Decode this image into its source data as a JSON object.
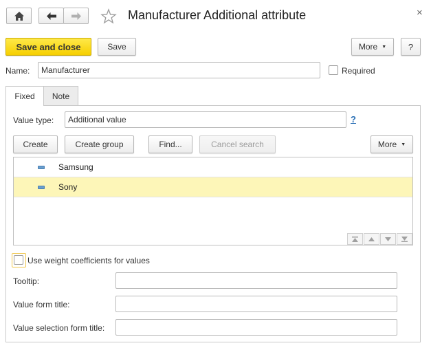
{
  "window": {
    "title": "Manufacturer Additional attribute",
    "close_glyph": "×"
  },
  "toolbar": {
    "save_close_label": "Save and close",
    "save_label": "Save",
    "more_label": "More",
    "help_label": "?"
  },
  "form": {
    "name_label": "Name:",
    "name_value": "Manufacturer",
    "required_label": "Required",
    "required_checked": false
  },
  "tabs": [
    {
      "label": "Fixed",
      "active": true
    },
    {
      "label": "Note",
      "active": false
    }
  ],
  "fixed_tab": {
    "value_type_label": "Value type:",
    "value_type_value": "Additional value",
    "value_type_help": "?",
    "buttons": {
      "create": "Create",
      "create_group": "Create group",
      "find": "Find...",
      "cancel_search": "Cancel search",
      "more": "More"
    },
    "values": [
      {
        "name": "Samsung",
        "selected": false
      },
      {
        "name": "Sony",
        "selected": true
      }
    ],
    "use_weight_label": "Use weight coefficients for values",
    "use_weight_checked": false,
    "tooltip_label": "Tooltip:",
    "tooltip_value": "",
    "value_form_title_label": "Value form title:",
    "value_form_title_value": "",
    "value_selection_form_title_label": "Value selection form title:",
    "value_selection_form_title_value": ""
  },
  "colors": {
    "primary_button": "#f6cf00",
    "selected_row": "#fdf6b8",
    "help_link": "#2a6fb5"
  }
}
